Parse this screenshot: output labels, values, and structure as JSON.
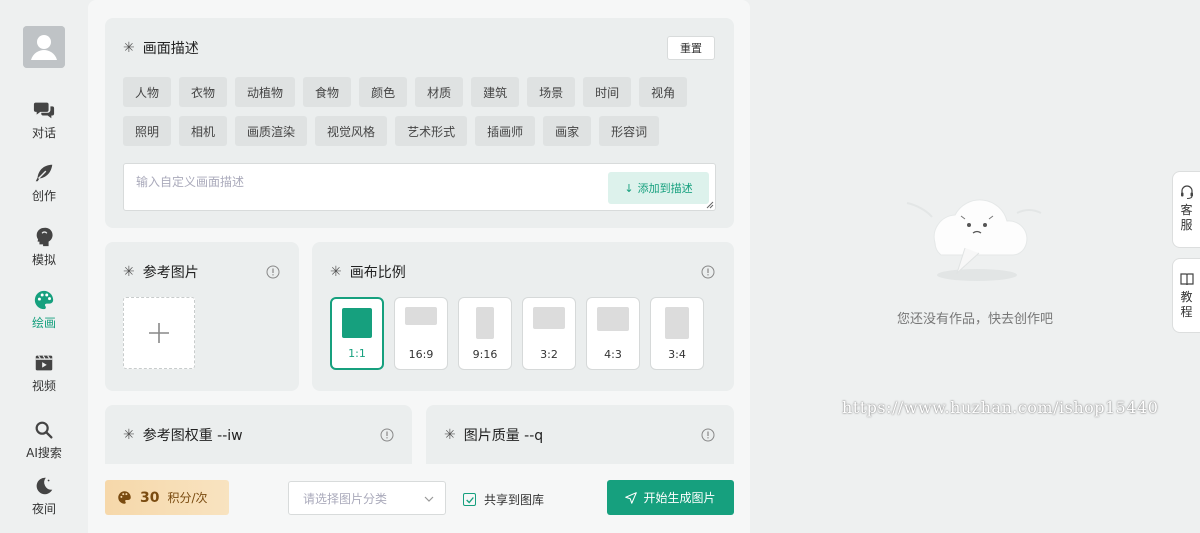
{
  "sidebar": {
    "items": [
      {
        "label": "对话",
        "icon": "chat-icon"
      },
      {
        "label": "创作",
        "icon": "feather-icon"
      },
      {
        "label": "模拟",
        "icon": "head-icon"
      },
      {
        "label": "绘画",
        "icon": "palette-icon",
        "active": true
      },
      {
        "label": "视频",
        "icon": "video-icon"
      },
      {
        "label": "AI搜索",
        "icon": "search-icon"
      },
      {
        "label": "夜间",
        "icon": "moon-icon"
      }
    ]
  },
  "description": {
    "title": "画面描述",
    "reset_label": "重置",
    "tags_row1": [
      "人物",
      "衣物",
      "动植物",
      "食物",
      "颜色",
      "材质",
      "建筑",
      "场景",
      "时间",
      "视角"
    ],
    "tags_row2": [
      "照明",
      "相机",
      "画质渲染",
      "视觉风格",
      "艺术形式",
      "插画师",
      "画家",
      "形容词"
    ],
    "input_placeholder": "输入自定义画面描述",
    "add_label": "添加到描述"
  },
  "reference": {
    "title": "参考图片"
  },
  "canvas": {
    "title": "画布比例",
    "ratios": [
      {
        "label": "1:1",
        "active": true
      },
      {
        "label": "16:9"
      },
      {
        "label": "9:16"
      },
      {
        "label": "3:2"
      },
      {
        "label": "4:3"
      },
      {
        "label": "3:4"
      }
    ]
  },
  "weight": {
    "title": "参考图权重 --iw"
  },
  "quality": {
    "title": "图片质量 --q"
  },
  "bottom": {
    "points_value": "30",
    "points_unit": "积分/次",
    "category_placeholder": "请选择图片分类",
    "share_label": "共享到图库",
    "generate_label": "开始生成图片"
  },
  "right": {
    "empty_text": "您还没有作品，快去创作吧",
    "watermark": "https://www.huzhan.com/ishop15440",
    "service_label": [
      "客",
      "服"
    ],
    "tutorial_label": [
      "教",
      "程"
    ]
  },
  "colors": {
    "accent": "#16a07e",
    "points_bg": "#f6d8aa"
  }
}
